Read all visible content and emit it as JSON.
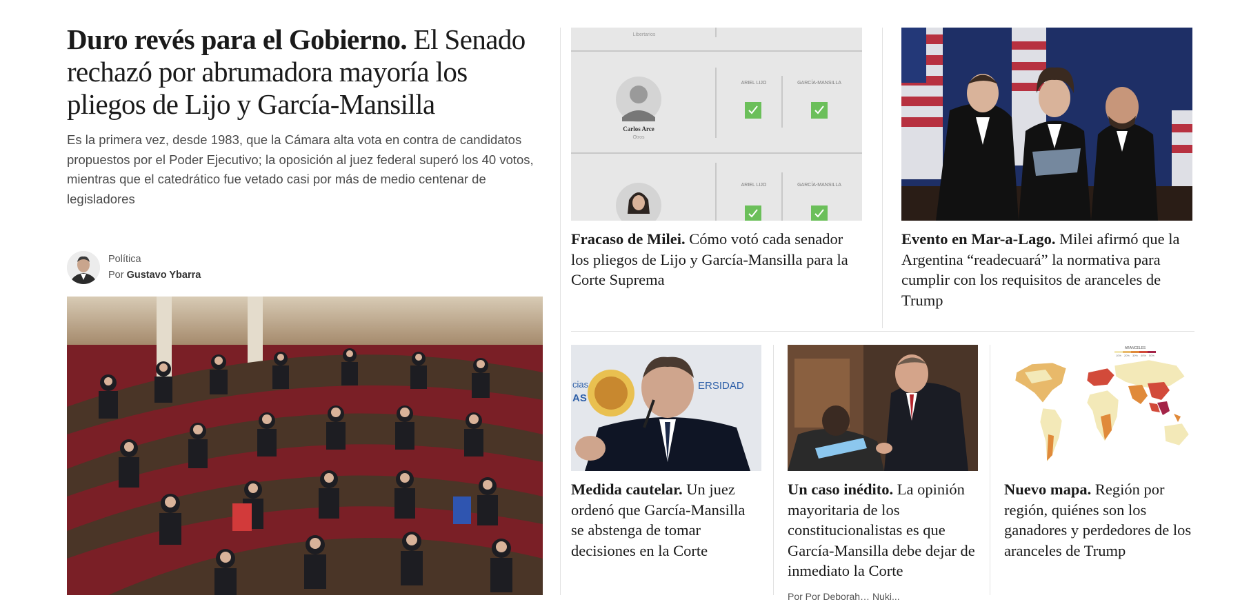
{
  "lead": {
    "kicker": "Duro revés para el Gobierno.",
    "title": " El Senado rechazó por abrumadora mayoría los pliegos de Lijo y García-Mansilla",
    "summary": "Es la primera vez, desde 1983, que la Cámara alta vota en contra de candidatos propuestos por el Poder Ejecutivo; la oposición al juez federal superó los 40 votos, mientras que el catedrático fue vetado casi por más de medio centenar de legisladores",
    "section": "Política",
    "author_prefix": "Por ",
    "author": "Gustavo Ybarra"
  },
  "cards": [
    {
      "kicker": "Fracaso de Milei.",
      "text": " Cómo votó cada senador los pliegos de Lijo y García-Mansilla para la Corte Suprema",
      "graphic": {
        "top_caption": "Libertarios",
        "rows": [
          {
            "name": "Carlos Arce",
            "party": "Otros",
            "col1": "ARIEL LIJO",
            "col2": "GARCÍA-MANSILLA"
          },
          {
            "name": "",
            "party": "",
            "col1": "ARIEL LIJO",
            "col2": "GARCÍA-MANSILLA"
          }
        ]
      }
    },
    {
      "kicker": "Evento en Mar-a-Lago.",
      "text": " Milei afirmó que la Argentina “readecuará” la normativa para cumplir con los requisitos de aranceles de Trump"
    },
    {
      "kicker": "Medida cautelar.",
      "text": " Un juez ordenó que García-Mansilla se abstenga de tomar decisiones en la Corte",
      "photo_text_1": "cias",
      "photo_text_2": "AS",
      "photo_text_3": "ERSIDAD"
    },
    {
      "kicker": "Un caso inédito.",
      "text": " La opinión mayoritaria de los constitucionalistas es que García-Mansilla debe dejar de inmediato la Corte"
    },
    {
      "kicker": "Nuevo mapa.",
      "text": " Región por región, quiénes son los ganadores y perdedores de los aranceles de Trump",
      "map_legend_title": "ARANCELES",
      "map_legend_ticks": [
        "10%",
        "20%",
        "30%",
        "40%",
        "50%"
      ]
    }
  ],
  "trailing_byline": "Por Por Deborah… Nuki..."
}
